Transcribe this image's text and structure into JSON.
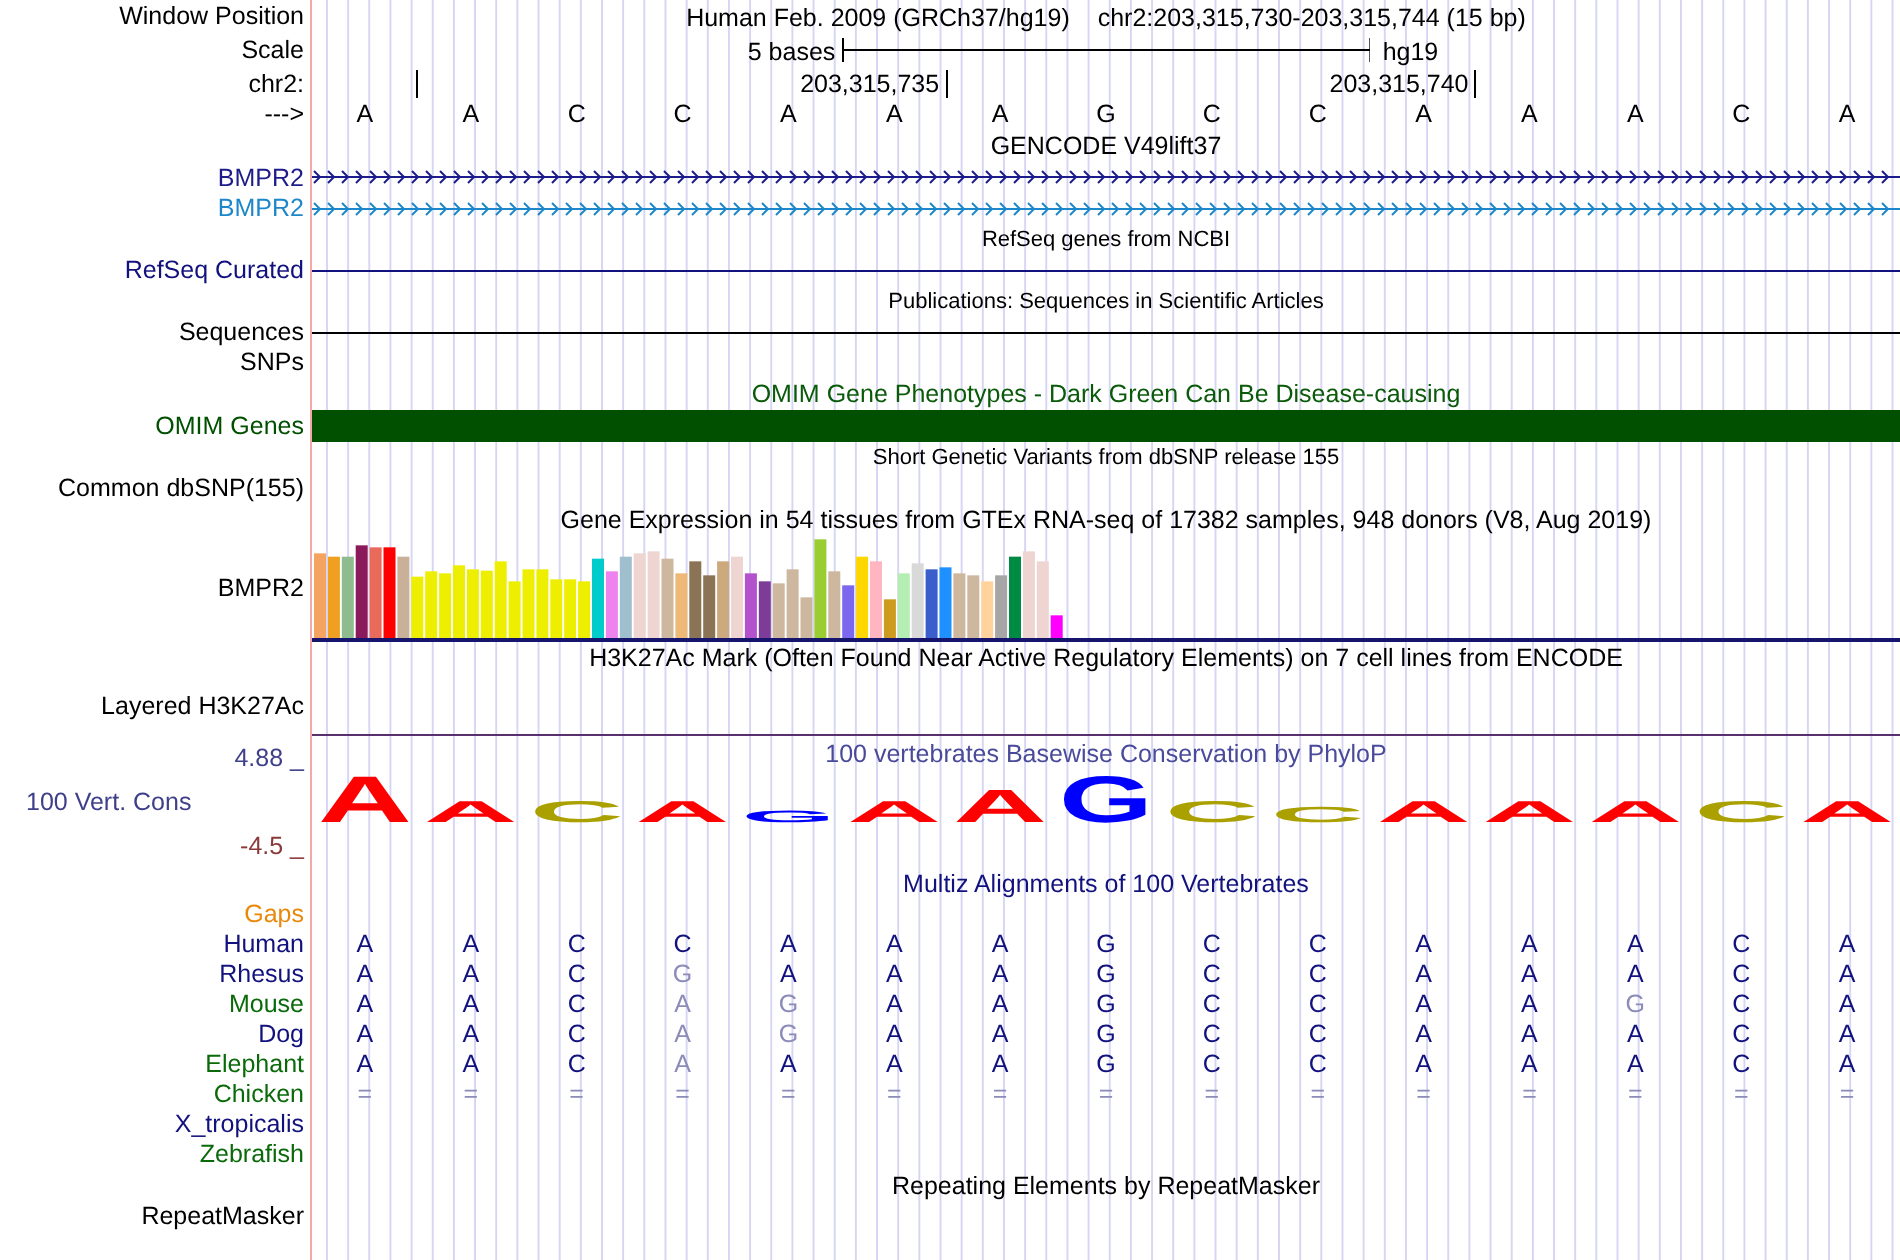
{
  "ruler": {
    "window_label": "Window Position",
    "assembly": "Human Feb. 2009 (GRCh37/hg19)",
    "position": "chr2:203,315,730-203,315,744 (15 bp)",
    "scale_label": "Scale",
    "scale_span": "5 bases",
    "scale_db": "hg19",
    "chrom_label": "chr2:",
    "ticks": [
      "203,315,735",
      "203,315,740"
    ],
    "strand_label": "--->",
    "bases": [
      "A",
      "A",
      "C",
      "C",
      "A",
      "A",
      "A",
      "G",
      "C",
      "C",
      "A",
      "A",
      "A",
      "C",
      "A"
    ]
  },
  "tracks": [
    {
      "kind": "gene",
      "title": "GENCODE V49lift37",
      "rows": [
        {
          "label": "BMPR2",
          "color": "#1c1c8a"
        },
        {
          "label": "BMPR2",
          "color": "#1d87c9"
        }
      ]
    },
    {
      "kind": "line",
      "title": "RefSeq genes from NCBI",
      "rows": [
        {
          "label": "RefSeq Curated",
          "color": "#12127e"
        }
      ]
    },
    {
      "kind": "line",
      "title": "Publications: Sequences in Scientific Articles",
      "rows": [
        {
          "label": "Sequences",
          "color": "#000000"
        },
        {
          "label": "SNPs"
        }
      ]
    },
    {
      "kind": "block",
      "title": "OMIM Gene Phenotypes - Dark Green Can Be Disease-causing",
      "rows": [
        {
          "label": "OMIM Genes",
          "color": "#005000"
        }
      ]
    },
    {
      "kind": "empty",
      "title": "Short Genetic Variants from dbSNP release 155",
      "rows": [
        {
          "label": "Common dbSNP(155)"
        }
      ]
    },
    {
      "kind": "gtex",
      "title": "Gene Expression in 54 tissues from GTEx RNA-seq of 17382 samples, 948 donors (V8, Aug 2019)",
      "rows": [
        {
          "label": "BMPR2"
        }
      ]
    },
    {
      "kind": "layered",
      "title": "H3K27Ac Mark (Often Found Near Active Regulatory Elements) on 7 cell lines from ENCODE",
      "rows": [
        {
          "label": "Layered H3K27Ac"
        }
      ]
    },
    {
      "kind": "logo",
      "title": "100 vertebrates Basewise Conservation by PhyloP",
      "label": "100 Vert. Cons",
      "ymax": "4.88 _",
      "ymin": "-4.5 _",
      "letters": [
        {
          "base": "A",
          "color": "#ff0000"
        },
        {
          "base": "A",
          "color": "#ff0000"
        },
        {
          "base": "C",
          "color": "#aaa000"
        },
        {
          "base": "A",
          "color": "#ff0000"
        },
        {
          "base": "G",
          "color": "#0000ff"
        },
        {
          "base": "A",
          "color": "#ff0000"
        },
        {
          "base": "A",
          "color": "#ff0000"
        },
        {
          "base": "G",
          "color": "#0000ff"
        },
        {
          "base": "C",
          "color": "#aaa000"
        },
        {
          "base": "C",
          "color": "#aaa000"
        },
        {
          "base": "A",
          "color": "#ff0000"
        },
        {
          "base": "A",
          "color": "#ff0000"
        },
        {
          "base": "A",
          "color": "#ff0000"
        },
        {
          "base": "C",
          "color": "#aaa000"
        },
        {
          "base": "A",
          "color": "#ff0000"
        }
      ]
    },
    {
      "kind": "multiz",
      "title": "Multiz Alignments of 100 Vertebrates",
      "rows": [
        {
          "label": "Gaps",
          "color": "#e8890c"
        },
        {
          "label": "Human",
          "color": "#12127e",
          "bases": [
            {
              "base": "A",
              "match": true
            },
            {
              "base": "A",
              "match": true
            },
            {
              "base": "C",
              "match": true
            },
            {
              "base": "C",
              "match": true
            },
            {
              "base": "A",
              "match": true
            },
            {
              "base": "A",
              "match": true
            },
            {
              "base": "A",
              "match": true
            },
            {
              "base": "G",
              "match": true
            },
            {
              "base": "C",
              "match": true
            },
            {
              "base": "C",
              "match": true
            },
            {
              "base": "A",
              "match": true
            },
            {
              "base": "A",
              "match": true
            },
            {
              "base": "A",
              "match": true
            },
            {
              "base": "C",
              "match": true
            },
            {
              "base": "A",
              "match": true
            }
          ]
        },
        {
          "label": "Rhesus",
          "color": "#12127e",
          "bases": [
            {
              "base": "A",
              "match": true
            },
            {
              "base": "A",
              "match": true
            },
            {
              "base": "C",
              "match": true
            },
            {
              "base": "G",
              "match": false
            },
            {
              "base": "A",
              "match": true
            },
            {
              "base": "A",
              "match": true
            },
            {
              "base": "A",
              "match": true
            },
            {
              "base": "G",
              "match": true
            },
            {
              "base": "C",
              "match": true
            },
            {
              "base": "C",
              "match": true
            },
            {
              "base": "A",
              "match": true
            },
            {
              "base": "A",
              "match": true
            },
            {
              "base": "A",
              "match": true
            },
            {
              "base": "C",
              "match": true
            },
            {
              "base": "A",
              "match": true
            }
          ]
        },
        {
          "label": "Mouse",
          "color": "#0a6a0a",
          "bases": [
            {
              "base": "A",
              "match": true
            },
            {
              "base": "A",
              "match": true
            },
            {
              "base": "C",
              "match": true
            },
            {
              "base": "A",
              "match": false
            },
            {
              "base": "G",
              "match": false
            },
            {
              "base": "A",
              "match": true
            },
            {
              "base": "A",
              "match": true
            },
            {
              "base": "G",
              "match": true
            },
            {
              "base": "C",
              "match": true
            },
            {
              "base": "C",
              "match": true
            },
            {
              "base": "A",
              "match": true
            },
            {
              "base": "A",
              "match": true
            },
            {
              "base": "G",
              "match": false
            },
            {
              "base": "C",
              "match": true
            },
            {
              "base": "A",
              "match": true
            }
          ]
        },
        {
          "label": "Dog",
          "color": "#12127e",
          "bases": [
            {
              "base": "A",
              "match": true
            },
            {
              "base": "A",
              "match": true
            },
            {
              "base": "C",
              "match": true
            },
            {
              "base": "A",
              "match": false
            },
            {
              "base": "G",
              "match": false
            },
            {
              "base": "A",
              "match": true
            },
            {
              "base": "A",
              "match": true
            },
            {
              "base": "G",
              "match": true
            },
            {
              "base": "C",
              "match": true
            },
            {
              "base": "C",
              "match": true
            },
            {
              "base": "A",
              "match": true
            },
            {
              "base": "A",
              "match": true
            },
            {
              "base": "A",
              "match": true
            },
            {
              "base": "C",
              "match": true
            },
            {
              "base": "A",
              "match": true
            }
          ]
        },
        {
          "label": "Elephant",
          "color": "#0a6a0a",
          "bases": [
            {
              "base": "A",
              "match": true
            },
            {
              "base": "A",
              "match": true
            },
            {
              "base": "C",
              "match": true
            },
            {
              "base": "A",
              "match": false
            },
            {
              "base": "A",
              "match": true
            },
            {
              "base": "A",
              "match": true
            },
            {
              "base": "A",
              "match": true
            },
            {
              "base": "G",
              "match": true
            },
            {
              "base": "C",
              "match": true
            },
            {
              "base": "C",
              "match": true
            },
            {
              "base": "A",
              "match": true
            },
            {
              "base": "A",
              "match": true
            },
            {
              "base": "A",
              "match": true
            },
            {
              "base": "C",
              "match": true
            },
            {
              "base": "A",
              "match": true
            }
          ]
        },
        {
          "label": "Chicken",
          "color": "#0a6a0a",
          "bases": [
            {
              "base": "=",
              "match": false
            },
            {
              "base": "=",
              "match": false
            },
            {
              "base": "=",
              "match": false
            },
            {
              "base": "=",
              "match": false
            },
            {
              "base": "=",
              "match": false
            },
            {
              "base": "=",
              "match": false
            },
            {
              "base": "=",
              "match": false
            },
            {
              "base": "=",
              "match": false
            },
            {
              "base": "=",
              "match": false
            },
            {
              "base": "=",
              "match": false
            },
            {
              "base": "=",
              "match": false
            },
            {
              "base": "=",
              "match": false
            },
            {
              "base": "=",
              "match": false
            },
            {
              "base": "=",
              "match": false
            },
            {
              "base": "=",
              "match": false
            }
          ]
        },
        {
          "label": "X_tropicalis",
          "color": "#12127e"
        },
        {
          "label": "Zebrafish",
          "color": "#0a6a0a"
        }
      ]
    },
    {
      "kind": "empty",
      "title": "Repeating Elements by RepeatMasker",
      "rows": [
        {
          "label": "RepeatMasker"
        }
      ]
    }
  ]
}
